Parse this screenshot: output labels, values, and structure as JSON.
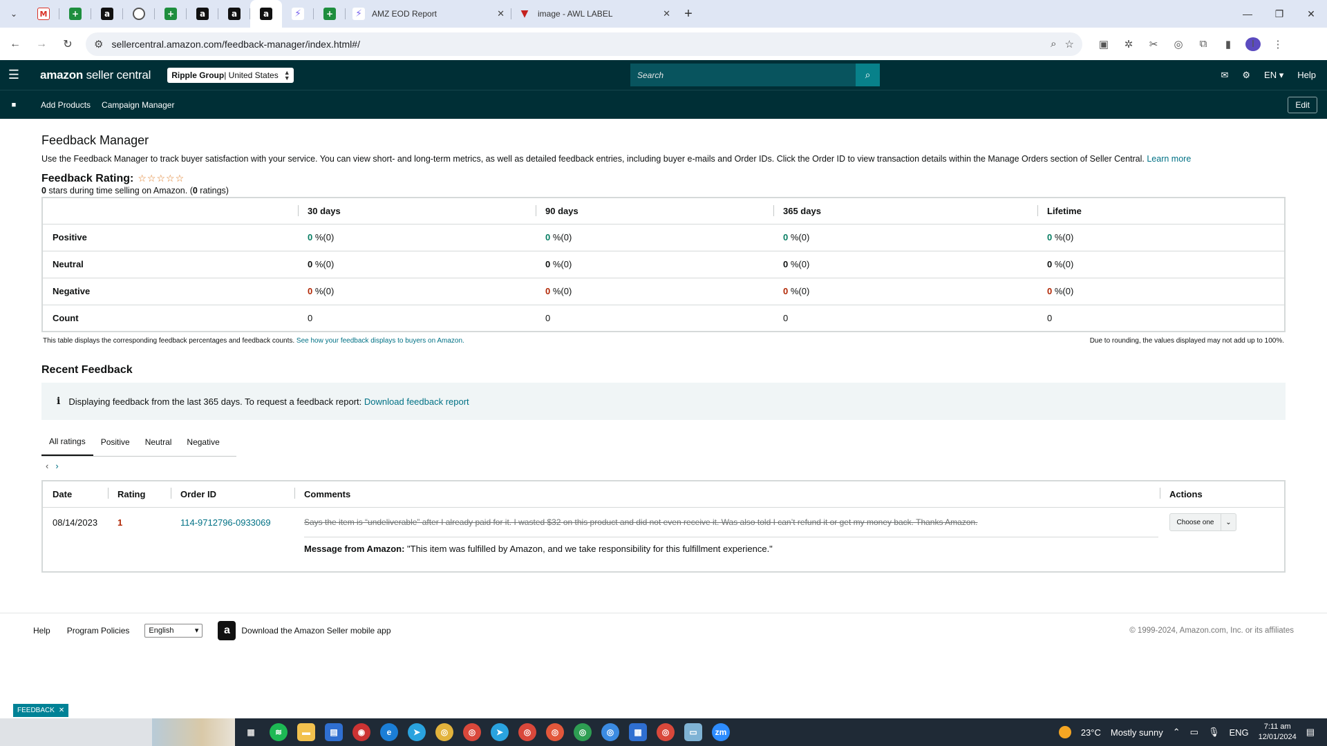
{
  "browser": {
    "tabs": [
      {
        "title": "AMZ EOD Report"
      },
      {
        "title": "image - AWL LABEL"
      }
    ],
    "url": "sellercentral.amazon.com/feedback-manager/index.html#/"
  },
  "header": {
    "logo_main": "amazon",
    "logo_rest": " seller central",
    "account_name": "Ripple Group",
    "account_region": " | United States",
    "search_placeholder": "Search",
    "language": "EN",
    "help": "Help"
  },
  "nav": {
    "add_products": "Add Products",
    "campaign_manager": "Campaign Manager",
    "edit": "Edit"
  },
  "page": {
    "title": "Feedback Manager",
    "intro": "Use the Feedback Manager to track buyer satisfaction with your service. You can view short- and long-term metrics, as well as detailed feedback entries, including buyer e-mails and Order IDs. Click the Order ID to view transaction details within the Manage Orders section of Seller Central.",
    "learn_more": "Learn more",
    "rating_label": "Feedback Rating:",
    "rating_stars": 0,
    "rating_zero": "0",
    "rating_text": " stars during time selling on Amazon. (",
    "rating_count": "0",
    "rating_text_end": " ratings)"
  },
  "metrics": {
    "columns": [
      "30 days",
      "90 days",
      "365 days",
      "Lifetime"
    ],
    "rows": [
      {
        "label": "Positive",
        "values": [
          "0",
          "0",
          "0",
          "0"
        ],
        "suffix": " %(0)"
      },
      {
        "label": "Neutral",
        "values": [
          "0",
          "0",
          "0",
          "0"
        ],
        "suffix": " %(0)"
      },
      {
        "label": "Negative",
        "values": [
          "0",
          "0",
          "0",
          "0"
        ],
        "suffix": " %(0)"
      },
      {
        "label": "Count",
        "values": [
          "0",
          "0",
          "0",
          "0"
        ],
        "suffix": ""
      }
    ],
    "foot_left": "This table displays the corresponding feedback percentages and feedback counts.",
    "foot_link": "See how your feedback displays to buyers on Amazon.",
    "foot_right": "Due to rounding, the values displayed may not add up to 100%."
  },
  "recent": {
    "title": "Recent Feedback",
    "info_text": "Displaying feedback from the last 365 days. To request a feedback report:",
    "info_link": "Download feedback report",
    "tabs": [
      "All ratings",
      "Positive",
      "Neutral",
      "Negative"
    ],
    "columns": [
      "Date",
      "Rating",
      "Order ID",
      "Comments",
      "Actions"
    ],
    "rows": [
      {
        "date": "08/14/2023",
        "rating": "1",
        "order_id": "114-9712796-0933069",
        "comment": "Says the item is “undeliverable” after I already paid for it. I wasted $32 on this product and did not even receive it. Was also told I can’t refund it or get my money back. Thanks Amazon.",
        "amazon_label": "Message from Amazon:",
        "amazon_message": " \"This item was fulfilled by Amazon, and we take responsibility for this fulfillment experience.\"",
        "action": "Choose one"
      }
    ]
  },
  "footer": {
    "help": "Help",
    "program_policies": "Program Policies",
    "language": "English",
    "app_text": "Download the Amazon Seller mobile app",
    "copyright": "© 1999-2024, Amazon.com, Inc. or its affiliates"
  },
  "feedback_tab": "FEEDBACK",
  "taskbar": {
    "temperature": "23°C",
    "weather": "Mostly sunny",
    "lang": "ENG",
    "time": "7:11 am",
    "date": "12/01/2024"
  }
}
